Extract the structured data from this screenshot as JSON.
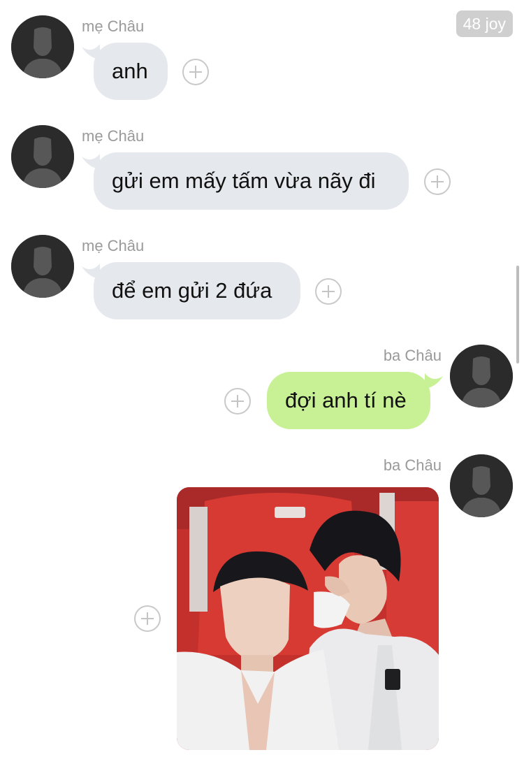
{
  "header": {
    "unread_badge": "48 joy"
  },
  "messages": [
    {
      "sender": "mẹ Châu",
      "text": "anh",
      "direction": "incoming"
    },
    {
      "sender": "mẹ Châu",
      "text": "gửi em mấy tấm vừa nãy đi",
      "direction": "incoming"
    },
    {
      "sender": "mẹ Châu",
      "text": "để em gửi 2 đứa",
      "direction": "incoming"
    },
    {
      "sender": "ba Châu",
      "text": "đợi anh tí nè",
      "direction": "outgoing"
    },
    {
      "sender": "ba Châu",
      "type": "photo",
      "direction": "outgoing"
    }
  ],
  "colors": {
    "incoming_bubble": "#e5e8ec",
    "outgoing_bubble": "#c8f095",
    "sender_text": "#9a9a9a",
    "badge_bg": "#cfcfcf"
  },
  "icons": {
    "avatar": "default-person-avatar-icon",
    "reaction": "add-reaction-plus-icon"
  }
}
